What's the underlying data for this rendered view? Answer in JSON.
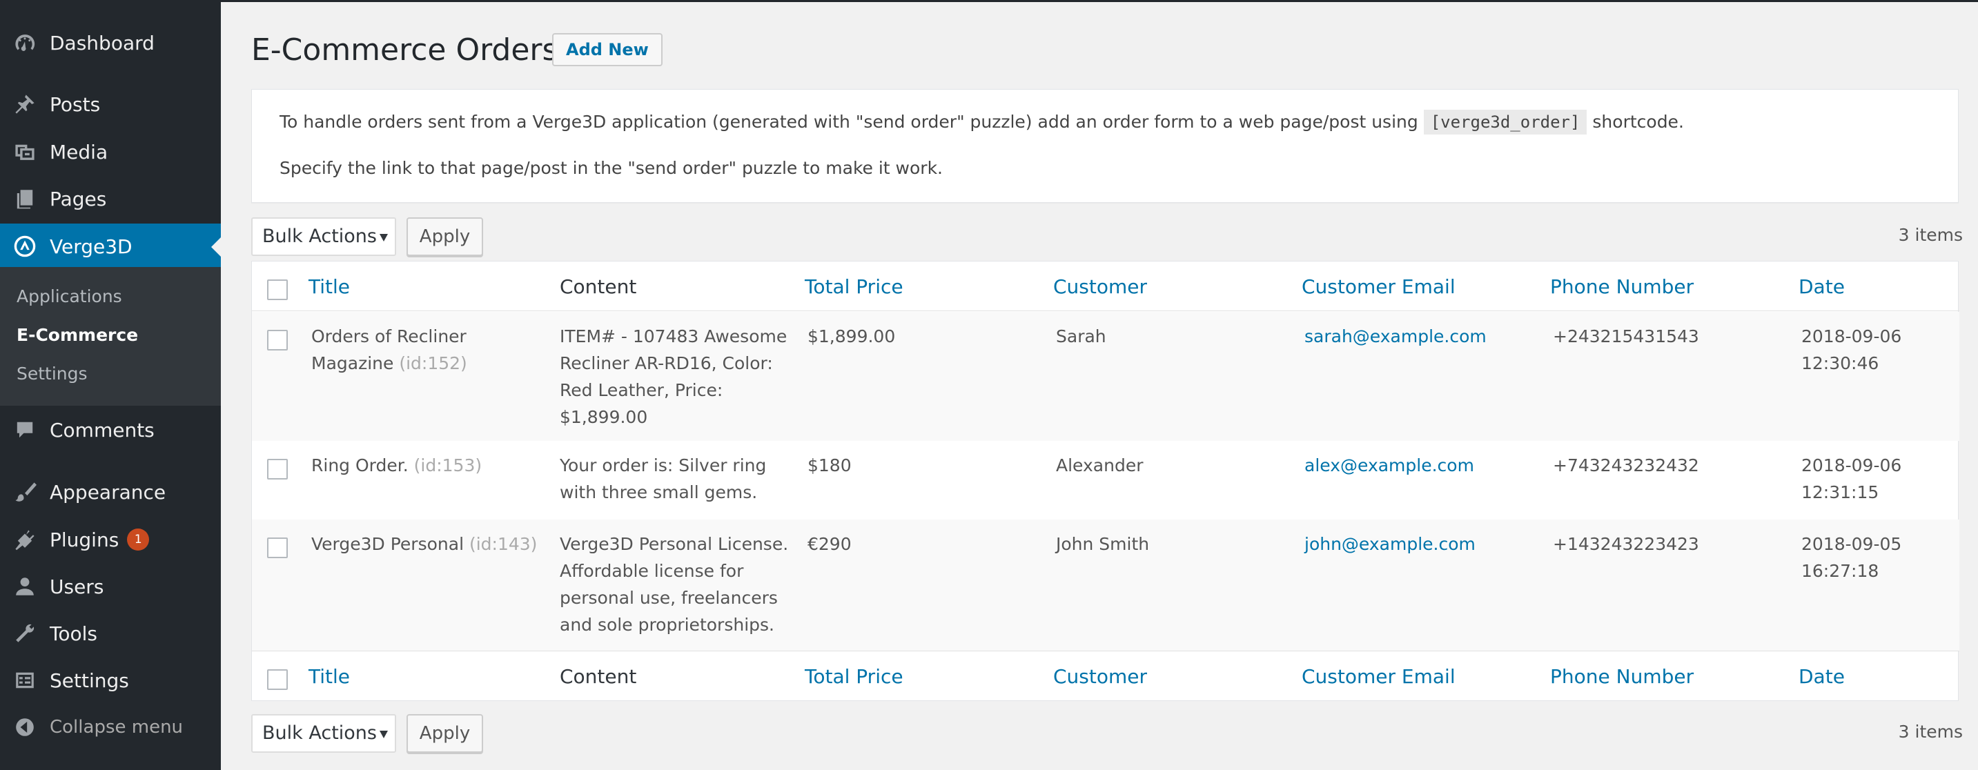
{
  "sidebar": {
    "items": [
      {
        "label": "Dashboard",
        "icon": "dashboard-icon"
      },
      {
        "label": "Posts",
        "icon": "pin-icon"
      },
      {
        "label": "Media",
        "icon": "media-icon"
      },
      {
        "label": "Pages",
        "icon": "pages-icon"
      },
      {
        "label": "Verge3D",
        "icon": "verge3d-icon",
        "active": true
      },
      {
        "label": "Comments",
        "icon": "comment-icon"
      },
      {
        "label": "Appearance",
        "icon": "brush-icon"
      },
      {
        "label": "Plugins",
        "icon": "plugin-icon",
        "badge": "1"
      },
      {
        "label": "Users",
        "icon": "user-icon"
      },
      {
        "label": "Tools",
        "icon": "wrench-icon"
      },
      {
        "label": "Settings",
        "icon": "settings-icon"
      },
      {
        "label": "Collapse menu",
        "icon": "collapse-icon"
      }
    ],
    "submenu": [
      {
        "label": "Applications"
      },
      {
        "label": "E-Commerce",
        "current": true
      },
      {
        "label": "Settings"
      }
    ]
  },
  "page": {
    "title": "E-Commerce Orders",
    "add_new_label": "Add New"
  },
  "notice": {
    "line1_before": "To handle orders sent from a Verge3D application (generated with \"send order\" puzzle) add an order form to a web page/post using",
    "line1_code": "[verge3d_order]",
    "line1_after": "shortcode.",
    "line2": "Specify the link to that page/post in the \"send order\" puzzle to make it work."
  },
  "tablenav": {
    "bulk_actions": "Bulk Actions",
    "apply": "Apply",
    "items_count": "3 items"
  },
  "table": {
    "columns": [
      "Title",
      "Content",
      "Total Price",
      "Customer",
      "Customer Email",
      "Phone Number",
      "Date"
    ],
    "rows": [
      {
        "title": "Orders of Recliner Magazine",
        "id": "(id:152)",
        "content": "ITEM# - 107483 Awesome Recliner AR-RD16, Color: Red Leather, Price: $1,899.00",
        "total_price": "$1,899.00",
        "customer": "Sarah",
        "email": "sarah@example.com",
        "phone": "+243215431543",
        "date": "2018-09-06 12:30:46"
      },
      {
        "title": "Ring Order.",
        "id": "(id:153)",
        "content": "Your order is: Silver ring with three small gems.",
        "total_price": "$180",
        "customer": "Alexander",
        "email": "alex@example.com",
        "phone": "+743243232432",
        "date": "2018-09-06 12:31:15"
      },
      {
        "title": "Verge3D Personal",
        "id": "(id:143)",
        "content": "Verge3D Personal License. Affordable license for personal use, freelancers and sole proprietorships.",
        "total_price": "€290",
        "customer": "John Smith",
        "email": "john@example.com",
        "phone": "+143243223423",
        "date": "2018-09-05 16:27:18"
      }
    ]
  },
  "colors": {
    "sidebar_bg": "#23282d",
    "active_bg": "#0073aa",
    "link": "#0073aa",
    "badge": "#ca4a1f"
  }
}
